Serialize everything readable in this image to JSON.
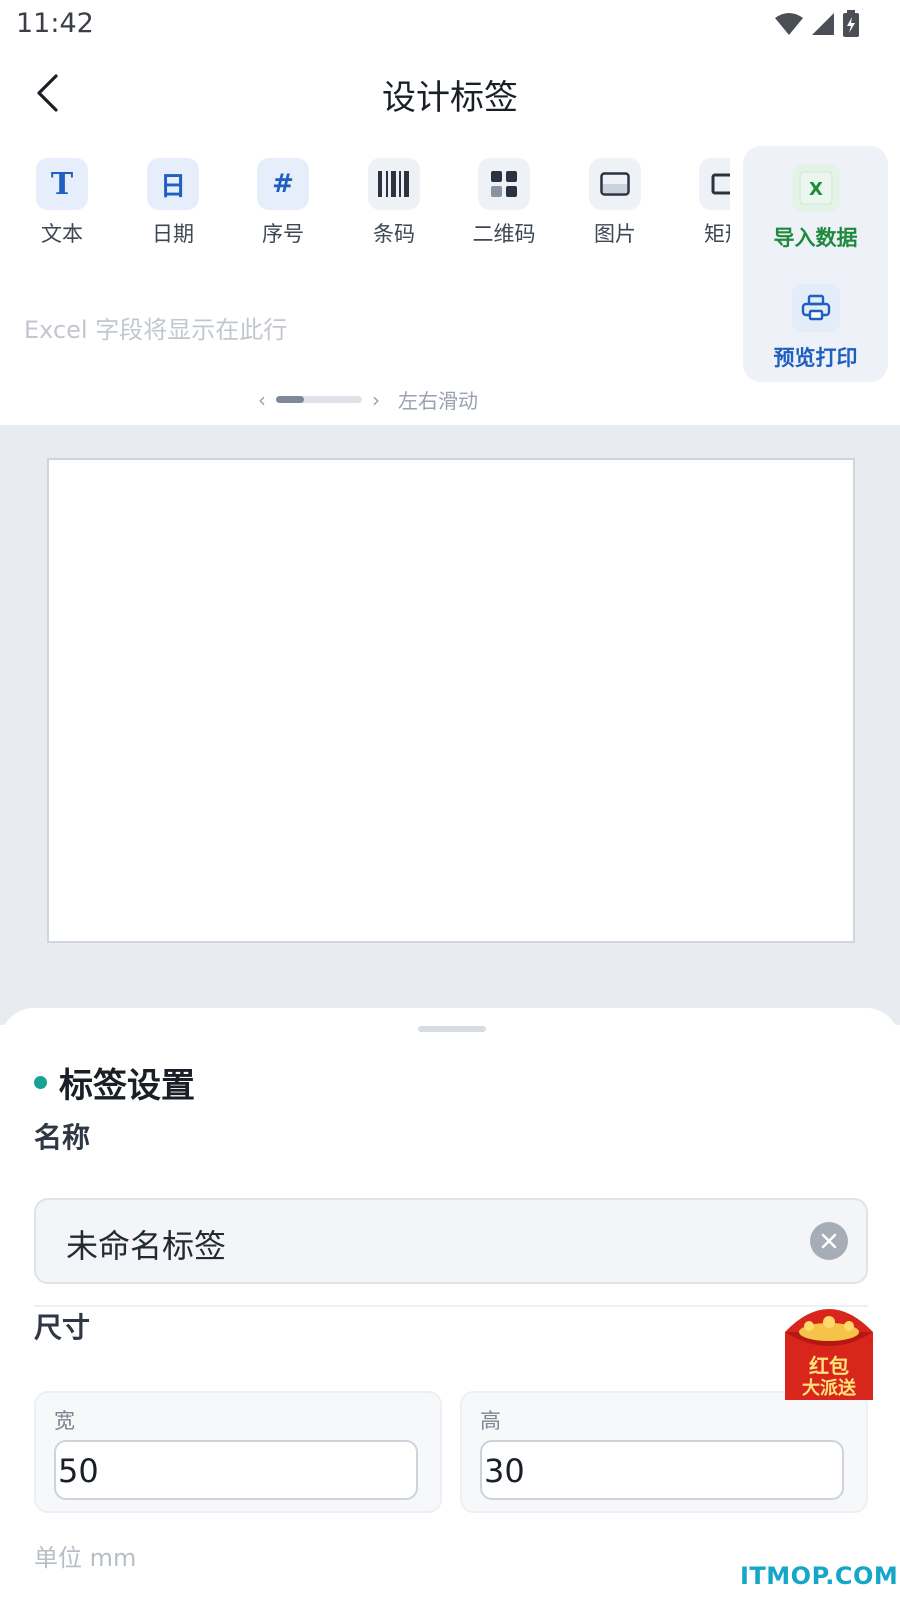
{
  "status_bar": {
    "time": "11:42"
  },
  "header": {
    "title": "设计标签"
  },
  "toolbar": {
    "items": [
      {
        "label": "文本",
        "icon": "text-icon",
        "glyph": "T"
      },
      {
        "label": "日期",
        "icon": "date-icon",
        "glyph": "日"
      },
      {
        "label": "序号",
        "icon": "serial-number-icon",
        "glyph": "#"
      },
      {
        "label": "条码",
        "icon": "barcode-icon"
      },
      {
        "label": "二维码",
        "icon": "qrcode-icon"
      },
      {
        "label": "图片",
        "icon": "image-icon"
      },
      {
        "label": "矩形",
        "icon": "rectangle-icon"
      }
    ]
  },
  "actions": {
    "import_label": "导入数据",
    "import_glyph": "X",
    "print_label": "预览打印"
  },
  "excel_hint": "Excel 字段将显示在此行",
  "scroll_hint": {
    "left_arrow": "‹",
    "right_arrow": "›",
    "text": "左右滑动",
    "position": 0.33
  },
  "sheet": {
    "title": "标签设置",
    "name_label": "名称",
    "name_value": "未命名标签",
    "size_label": "尺寸",
    "width_label": "宽",
    "width_value": "50",
    "height_label": "高",
    "height_value": "30",
    "unit_note": "单位 mm"
  },
  "red_packet": {
    "line1": "红包",
    "line2": "大派送"
  },
  "watermark": "ITMOP.COM",
  "colors": {
    "accent_blue": "#1f5fbf",
    "excel_green": "#1e8a3c",
    "dot_teal": "#16a394",
    "canvas_bg": "#e8ecf1",
    "red_packet": "#d9261c"
  }
}
